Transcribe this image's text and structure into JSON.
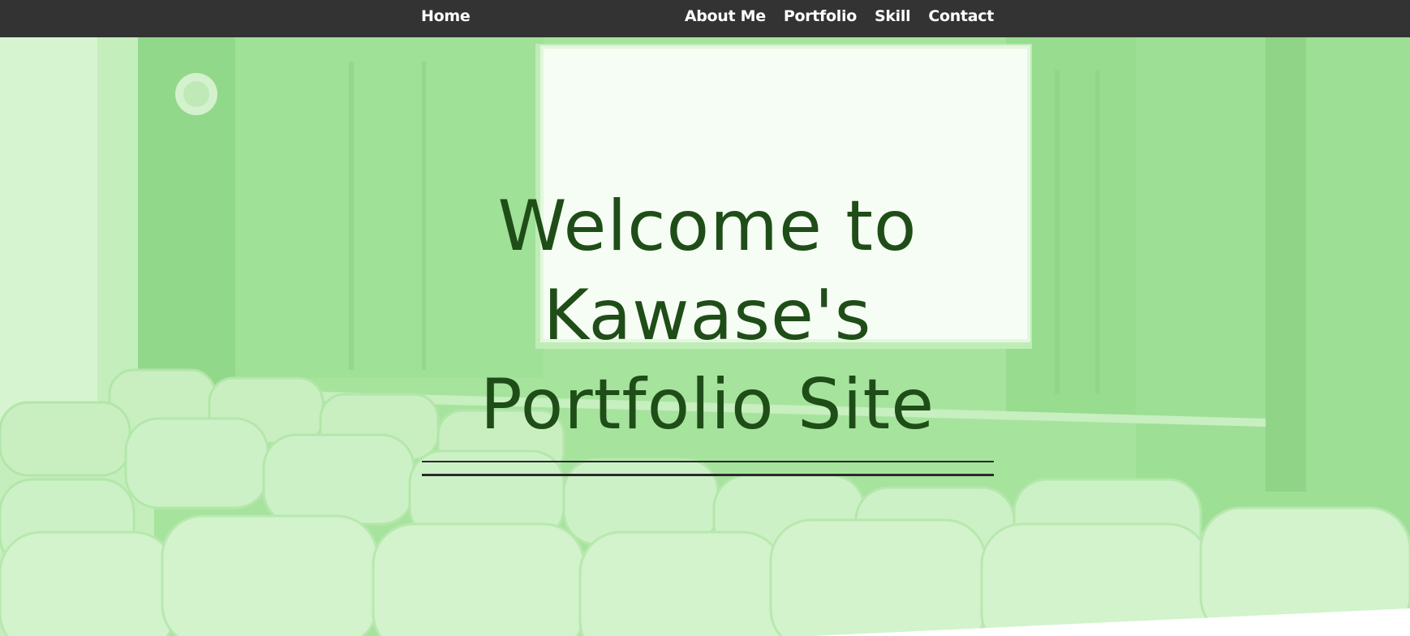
{
  "nav": {
    "home_label": "Home",
    "links": [
      {
        "label": "About Me"
      },
      {
        "label": "Portfolio"
      },
      {
        "label": "Skill"
      },
      {
        "label": "Contact"
      }
    ]
  },
  "hero": {
    "title_lines": [
      "Welcome to",
      "Kawase's",
      "Portfolio Site"
    ],
    "background": "theater-seats-and-screen-image"
  },
  "colors": {
    "navbar": "#333333",
    "nav_text": "#ffffff",
    "hero_tint": "#a8e6a0",
    "title_text": "#1f4d18",
    "rule": "#2a2a2a"
  }
}
